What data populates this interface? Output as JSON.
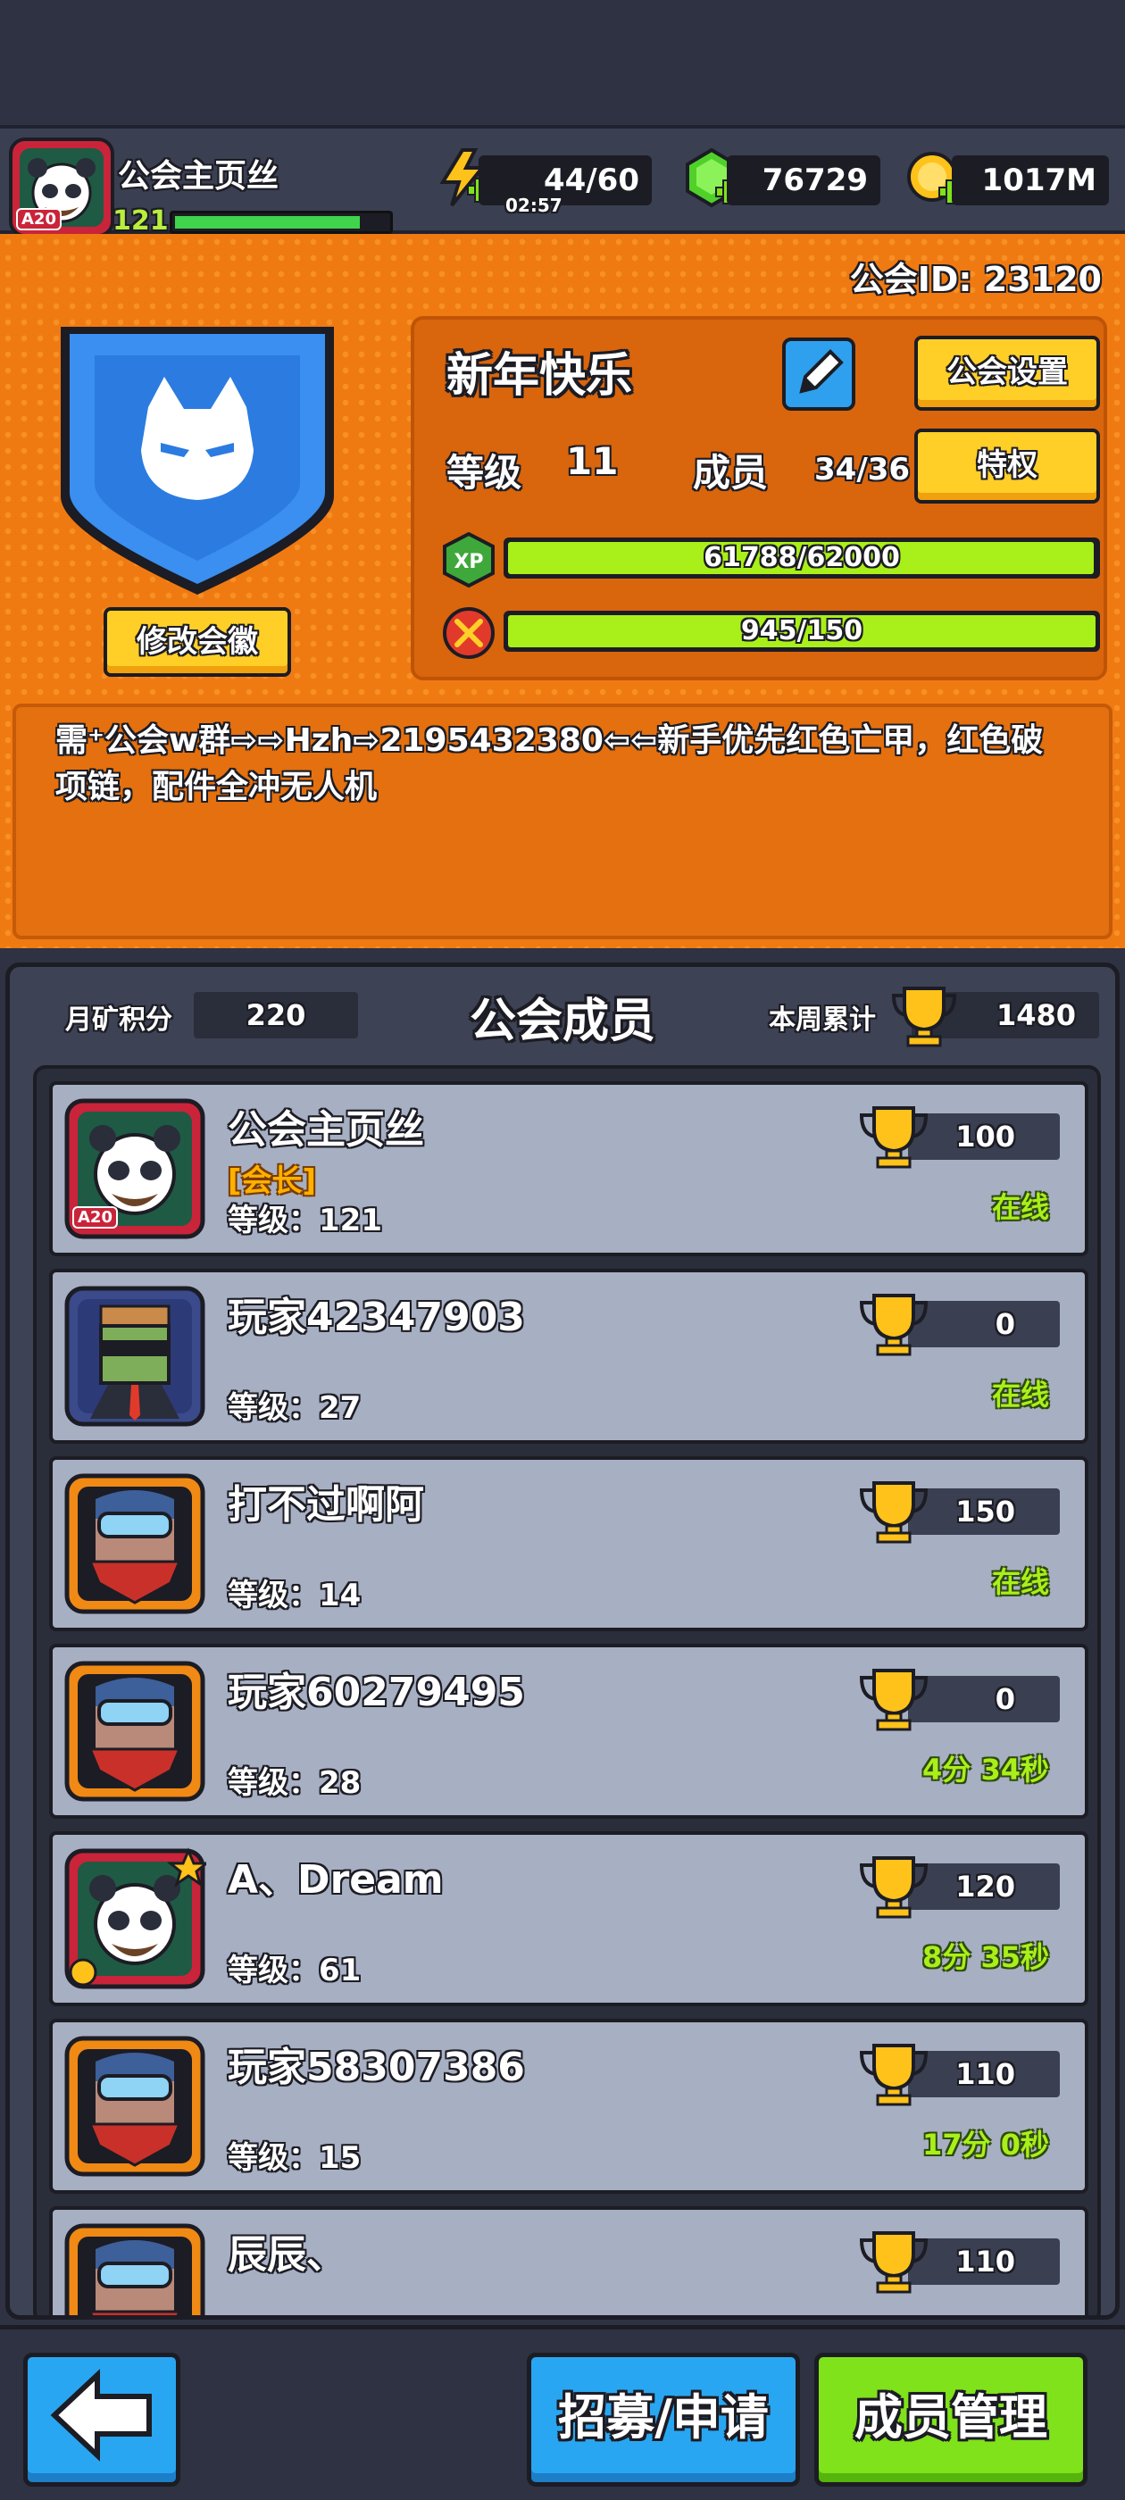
{
  "header": {
    "player_name": "公会主页丝",
    "player_level": "121",
    "player_badge": "A20",
    "xp_fraction": 0.85,
    "energy": "44/60",
    "energy_timer": "02:57",
    "gems": "76729",
    "gold": "1017M"
  },
  "guild": {
    "id_label": "公会ID: 23120",
    "name": "新年快乐",
    "change_emblem_label": "修改会徽",
    "settings_label": "公会设置",
    "privilege_label": "特权",
    "level_label": "等级",
    "level_value": "11",
    "members_label": "成员",
    "members_value": "34/36",
    "xp_icon_text": "XP",
    "xp_progress": "61788/62000",
    "xp_fraction": 0.9966,
    "contribution_progress": "945/150",
    "contribution_fraction": 1.0,
    "announcement": "需⁺公会w群⇨⇨Hzh⇨2195432380⇦⇦新手优先红色亡甲，红色破项链，配件全冲无人机"
  },
  "members_panel": {
    "monthly_label": "月矿积分",
    "monthly_value": "220",
    "title": "公会成员",
    "weekly_label": "本周累计",
    "weekly_value": "1480",
    "members": [
      {
        "name": "公会主页丝",
        "role": "[会长]",
        "level": "等级：121",
        "score": "100",
        "status": "在线",
        "avatar": "panda",
        "badge": "A20"
      },
      {
        "name": "玩家42347903",
        "role": "",
        "level": "等级：27",
        "score": "0",
        "status": "在线",
        "avatar": "zombie",
        "badge": ""
      },
      {
        "name": "打不过啊阿",
        "role": "",
        "level": "等级：14",
        "score": "150",
        "status": "在线",
        "avatar": "goggles",
        "badge": ""
      },
      {
        "name": "玩家60279495",
        "role": "",
        "level": "等级：28",
        "score": "0",
        "status": "4分 34秒",
        "avatar": "goggles",
        "badge": ""
      },
      {
        "name": "A、Dream",
        "role": "",
        "level": "等级：61",
        "score": "120",
        "status": "8分 35秒",
        "avatar": "panda-star",
        "badge": ""
      },
      {
        "name": "玩家58307386",
        "role": "",
        "level": "等级：15",
        "score": "110",
        "status": "17分 0秒",
        "avatar": "goggles",
        "badge": ""
      },
      {
        "name": "辰辰、",
        "role": "",
        "level": "",
        "score": "110",
        "status": "",
        "avatar": "goggles",
        "badge": ""
      }
    ]
  },
  "bottom_bar": {
    "recruit_label": "招募/申请",
    "manage_label": "成员管理"
  },
  "colors": {
    "orange_bg": "#f07a12",
    "button_yellow": "#ffcf27",
    "button_blue": "#29a6f2",
    "button_green": "#7fe21a",
    "progress_green": "#a9ef1a",
    "panel_dark": "#3d4254"
  }
}
